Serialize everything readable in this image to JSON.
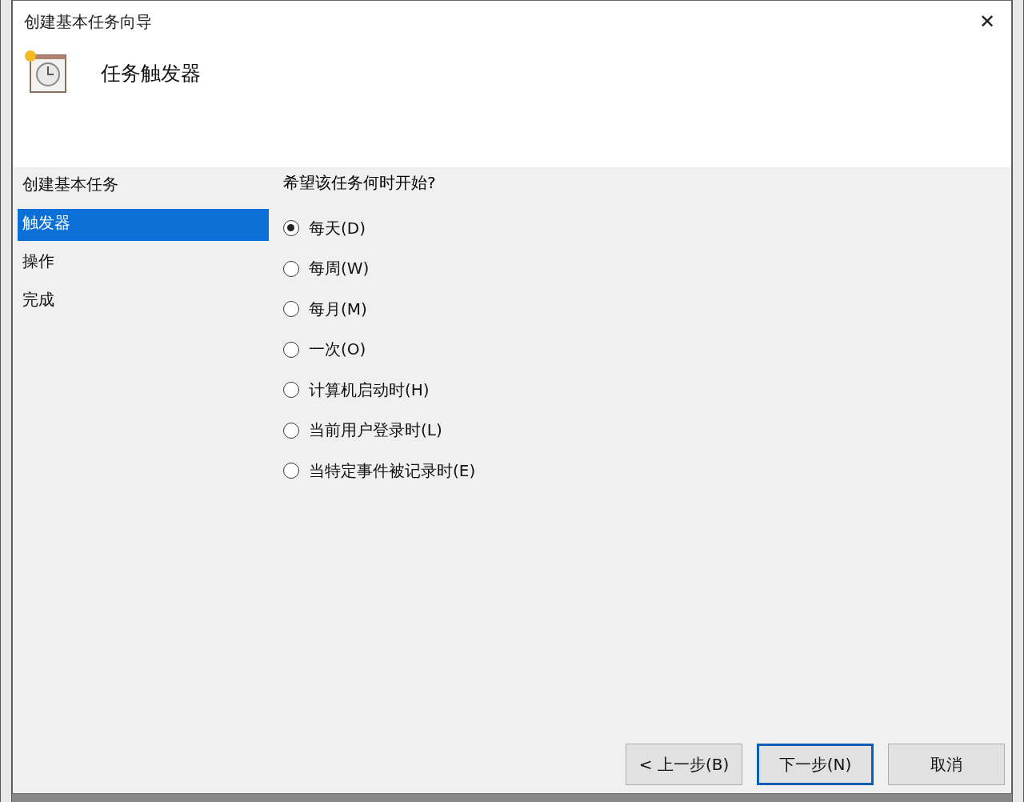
{
  "window": {
    "title": "创建基本任务向导",
    "close": "✕"
  },
  "header": {
    "heading": "任务触发器"
  },
  "steps": [
    {
      "label": "创建基本任务",
      "selected": false
    },
    {
      "label": "触发器",
      "selected": true
    },
    {
      "label": "操作",
      "selected": false
    },
    {
      "label": "完成",
      "selected": false
    }
  ],
  "question": "希望该任务何时开始?",
  "options": [
    {
      "label": "每天(D)",
      "selected": true
    },
    {
      "label": "每周(W)",
      "selected": false
    },
    {
      "label": "每月(M)",
      "selected": false
    },
    {
      "label": "一次(O)",
      "selected": false
    },
    {
      "label": "计算机启动时(H)",
      "selected": false
    },
    {
      "label": "当前用户登录时(L)",
      "selected": false
    },
    {
      "label": "当特定事件被记录时(E)",
      "selected": false
    }
  ],
  "buttons": [
    {
      "label": "< 上一步(B)",
      "kind": "normal"
    },
    {
      "label": "下一步(N)",
      "kind": "default"
    },
    {
      "label": "取消",
      "kind": "normal"
    }
  ]
}
